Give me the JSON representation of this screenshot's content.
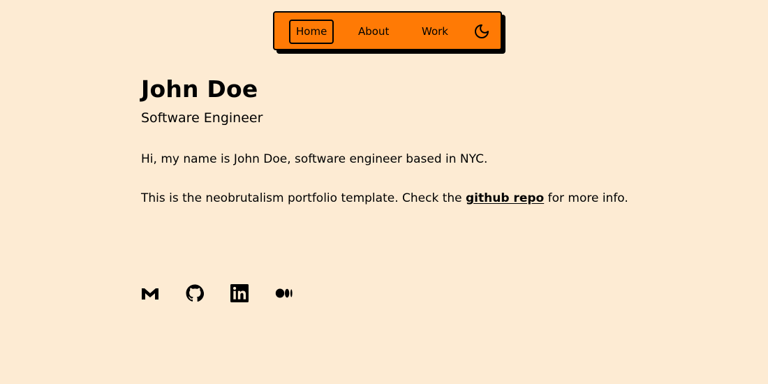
{
  "nav": {
    "items": [
      {
        "label": "Home",
        "active": true
      },
      {
        "label": "About",
        "active": false
      },
      {
        "label": "Work",
        "active": false
      }
    ],
    "theme_toggle_icon": "moon-icon"
  },
  "profile": {
    "name": "John Doe",
    "role": "Software Engineer"
  },
  "intro": {
    "line1": "Hi, my name is John Doe, software engineer based in NYC.",
    "line2_before": "This is the neobrutalism portfolio template. Check the ",
    "line2_link": "github repo",
    "line2_after": " for more info."
  },
  "socials": [
    {
      "icon": "gmail-icon"
    },
    {
      "icon": "github-icon"
    },
    {
      "icon": "linkedin-icon"
    },
    {
      "icon": "medium-icon"
    }
  ],
  "colors": {
    "background": "#fdebd3",
    "nav_background": "#ff7a05",
    "text": "#000000"
  }
}
